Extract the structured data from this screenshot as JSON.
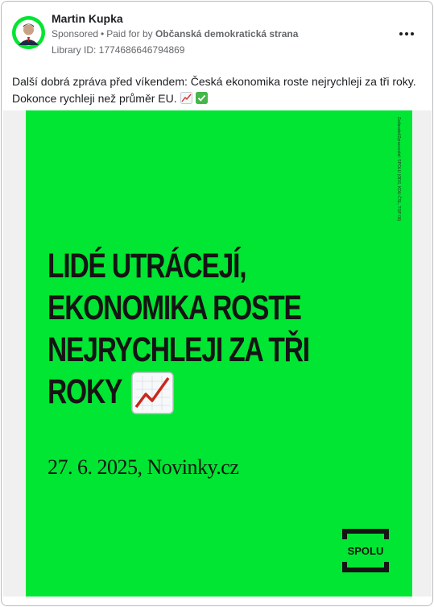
{
  "post": {
    "author": "Martin Kupka",
    "sponsored_label": "Sponsored",
    "separator": "•",
    "paid_for_prefix": "Paid for by",
    "payer": "Občanská demokratická strana",
    "library_id": "Library ID: 1774686646794869",
    "caption_line1": "Další dobrá zpráva před víkendem: Česká ekonomika roste nejrychleji za tři roky.",
    "caption_line2": "Dokonce rychleji než průměr EU.",
    "caption_emojis": [
      "chart-increasing-icon",
      "check-mark-button-icon"
    ]
  },
  "ad": {
    "headline": [
      "LIDÉ UTRÁCEJÍ,",
      "EKONOMIKA ROSTE",
      "NEJRYCHLEJI ZA TŘI",
      "ROKY"
    ],
    "source": "27. 6. 2025, Novinky.cz",
    "vertical_disclaimer": "Zadavatel/Zpracovatel: SPOLU (ODS, KDU-ČSL, TOP 09)",
    "logo_text": "SPOLU",
    "background_color": "#00e632",
    "text_color": "#141414"
  }
}
